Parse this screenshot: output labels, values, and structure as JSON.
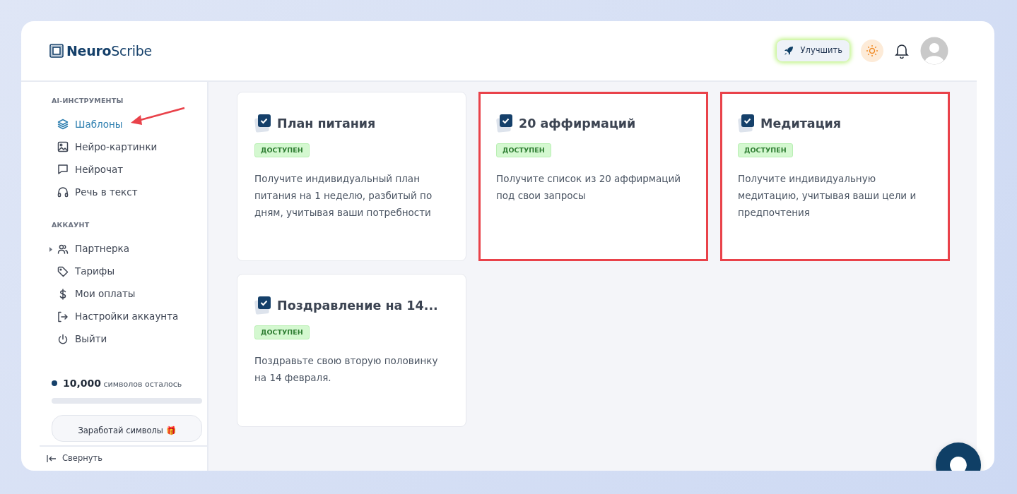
{
  "logo": {
    "bold": "Neuro",
    "light": "Scribe"
  },
  "header": {
    "upgrade_button": "Улучшить"
  },
  "sidebar": {
    "sections": [
      {
        "heading": "AI-ИНСТРУМЕНТЫ",
        "items": [
          {
            "label": "Шаблоны",
            "has_submenu": false,
            "selected": true
          },
          {
            "label": "Нейро-картинки",
            "has_submenu": false,
            "selected": false
          },
          {
            "label": "Нейрочат",
            "has_submenu": false,
            "selected": false
          },
          {
            "label": "Речь в текст",
            "has_submenu": false,
            "selected": false
          }
        ]
      },
      {
        "heading": "АККАУНТ",
        "items": [
          {
            "label": "Партнерка",
            "has_submenu": true,
            "selected": false
          },
          {
            "label": "Тарифы",
            "has_submenu": false,
            "selected": false
          },
          {
            "label": "Мои оплаты",
            "has_submenu": false,
            "selected": false
          },
          {
            "label": "Настройки аккаунта",
            "has_submenu": false,
            "selected": false
          },
          {
            "label": "Выйти",
            "has_submenu": false,
            "selected": false
          }
        ]
      }
    ],
    "credits": {
      "amount": "10,000",
      "unit": "символов осталось",
      "level": 0
    },
    "earn_button": "Заработай символы 🎁",
    "collapse": "Свернуть"
  },
  "templates": [
    {
      "title": "План питания",
      "badge": "ДОСТУПЕН",
      "description": "Получите индивидуальный план питания на 1 неделю, разбитый по дням, учитывая ваши потребности",
      "highlighted": false
    },
    {
      "title": "20 аффирмаций",
      "badge": "ДОСТУПЕН",
      "description": "Получите список из 20 аффирмаций под свои запросы",
      "highlighted": true
    },
    {
      "title": "Медитация",
      "badge": "ДОСТУПЕН",
      "description": "Получите индивидуальную медитацию, учитывая ваши цели и предпочтения",
      "highlighted": true
    },
    {
      "title": "Поздравление на 14...",
      "badge": "ДОСТУПЕН",
      "description": "Поздравьте свою вторую половинку на 14 февраля.",
      "highlighted": false
    }
  ]
}
